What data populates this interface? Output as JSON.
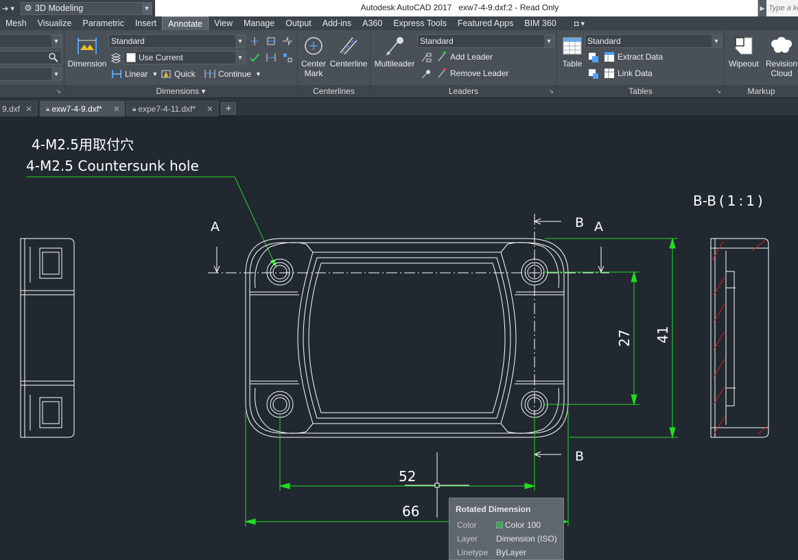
{
  "titlebar": {
    "workspace": "3D Modeling",
    "app_name": "Autodesk AutoCAD 2017",
    "file_title": "exw7-4-9.dxf:2 - Read Only",
    "search_placeholder": "Type a keyword or phrase"
  },
  "ribbon_tabs": [
    {
      "label": "Mesh"
    },
    {
      "label": "Visualize"
    },
    {
      "label": "Parametric"
    },
    {
      "label": "Insert"
    },
    {
      "label": "Annotate",
      "active": true
    },
    {
      "label": "View"
    },
    {
      "label": "Manage"
    },
    {
      "label": "Output"
    },
    {
      "label": "Add-ins"
    },
    {
      "label": "A360"
    },
    {
      "label": "Express Tools"
    },
    {
      "label": "Featured Apps"
    },
    {
      "label": "BIM 360"
    }
  ],
  "ribbon": {
    "dimensions": {
      "title": "Dimensions",
      "dimension_button": "Dimension",
      "style_value": "Standard",
      "layer_value": "Use Current",
      "linear": "Linear",
      "quick": "Quick",
      "continue": "Continue"
    },
    "centerlines": {
      "title": "Centerlines",
      "center_mark": "Center Mark",
      "center_mark_line1": "Center",
      "center_mark_line2": "Mark",
      "centerline": "Centerline"
    },
    "leaders": {
      "title": "Leaders",
      "multileader": "Multileader",
      "style_value": "Standard",
      "add_leader": "Add Leader",
      "remove_leader": "Remove Leader"
    },
    "tables": {
      "title": "Tables",
      "table": "Table",
      "style_value": "Standard",
      "extract_data": "Extract Data",
      "link_data": "Link Data"
    },
    "markup": {
      "title": "Markup",
      "wipeout": "Wipeout",
      "revision_cloud_line1": "Revision",
      "revision_cloud_line2": "Cloud"
    }
  },
  "doc_tabs": [
    {
      "label": "9.dxf",
      "active": false,
      "locked": false
    },
    {
      "label": "exw7-4-9.dxf*",
      "active": true,
      "locked": true
    },
    {
      "label": "expe7-4-11.dxf*",
      "active": false,
      "locked": true
    }
  ],
  "drawing": {
    "note_jp": "4-M2.5用取付穴",
    "note_en": "4-M2.5 Countersunk hole",
    "section_title": "B-B ( 1 : 1 )",
    "label_a_left": "A",
    "label_a_right": "A",
    "label_b_top": "B",
    "label_b_bottom": "B",
    "dim_27": "27",
    "dim_41": "41",
    "dim_52": "52",
    "dim_66": "66",
    "colors": {
      "geometry": "#ffffff",
      "dimension": "#22dd22",
      "hatch": "#e02020",
      "background": "#212830"
    }
  },
  "tooltip": {
    "title": "Rotated Dimension",
    "rows": [
      {
        "key": "Color",
        "value": "Color 100"
      },
      {
        "key": "Layer",
        "value": "Dimension (ISO)"
      },
      {
        "key": "Linetype",
        "value": "ByLayer"
      }
    ]
  }
}
